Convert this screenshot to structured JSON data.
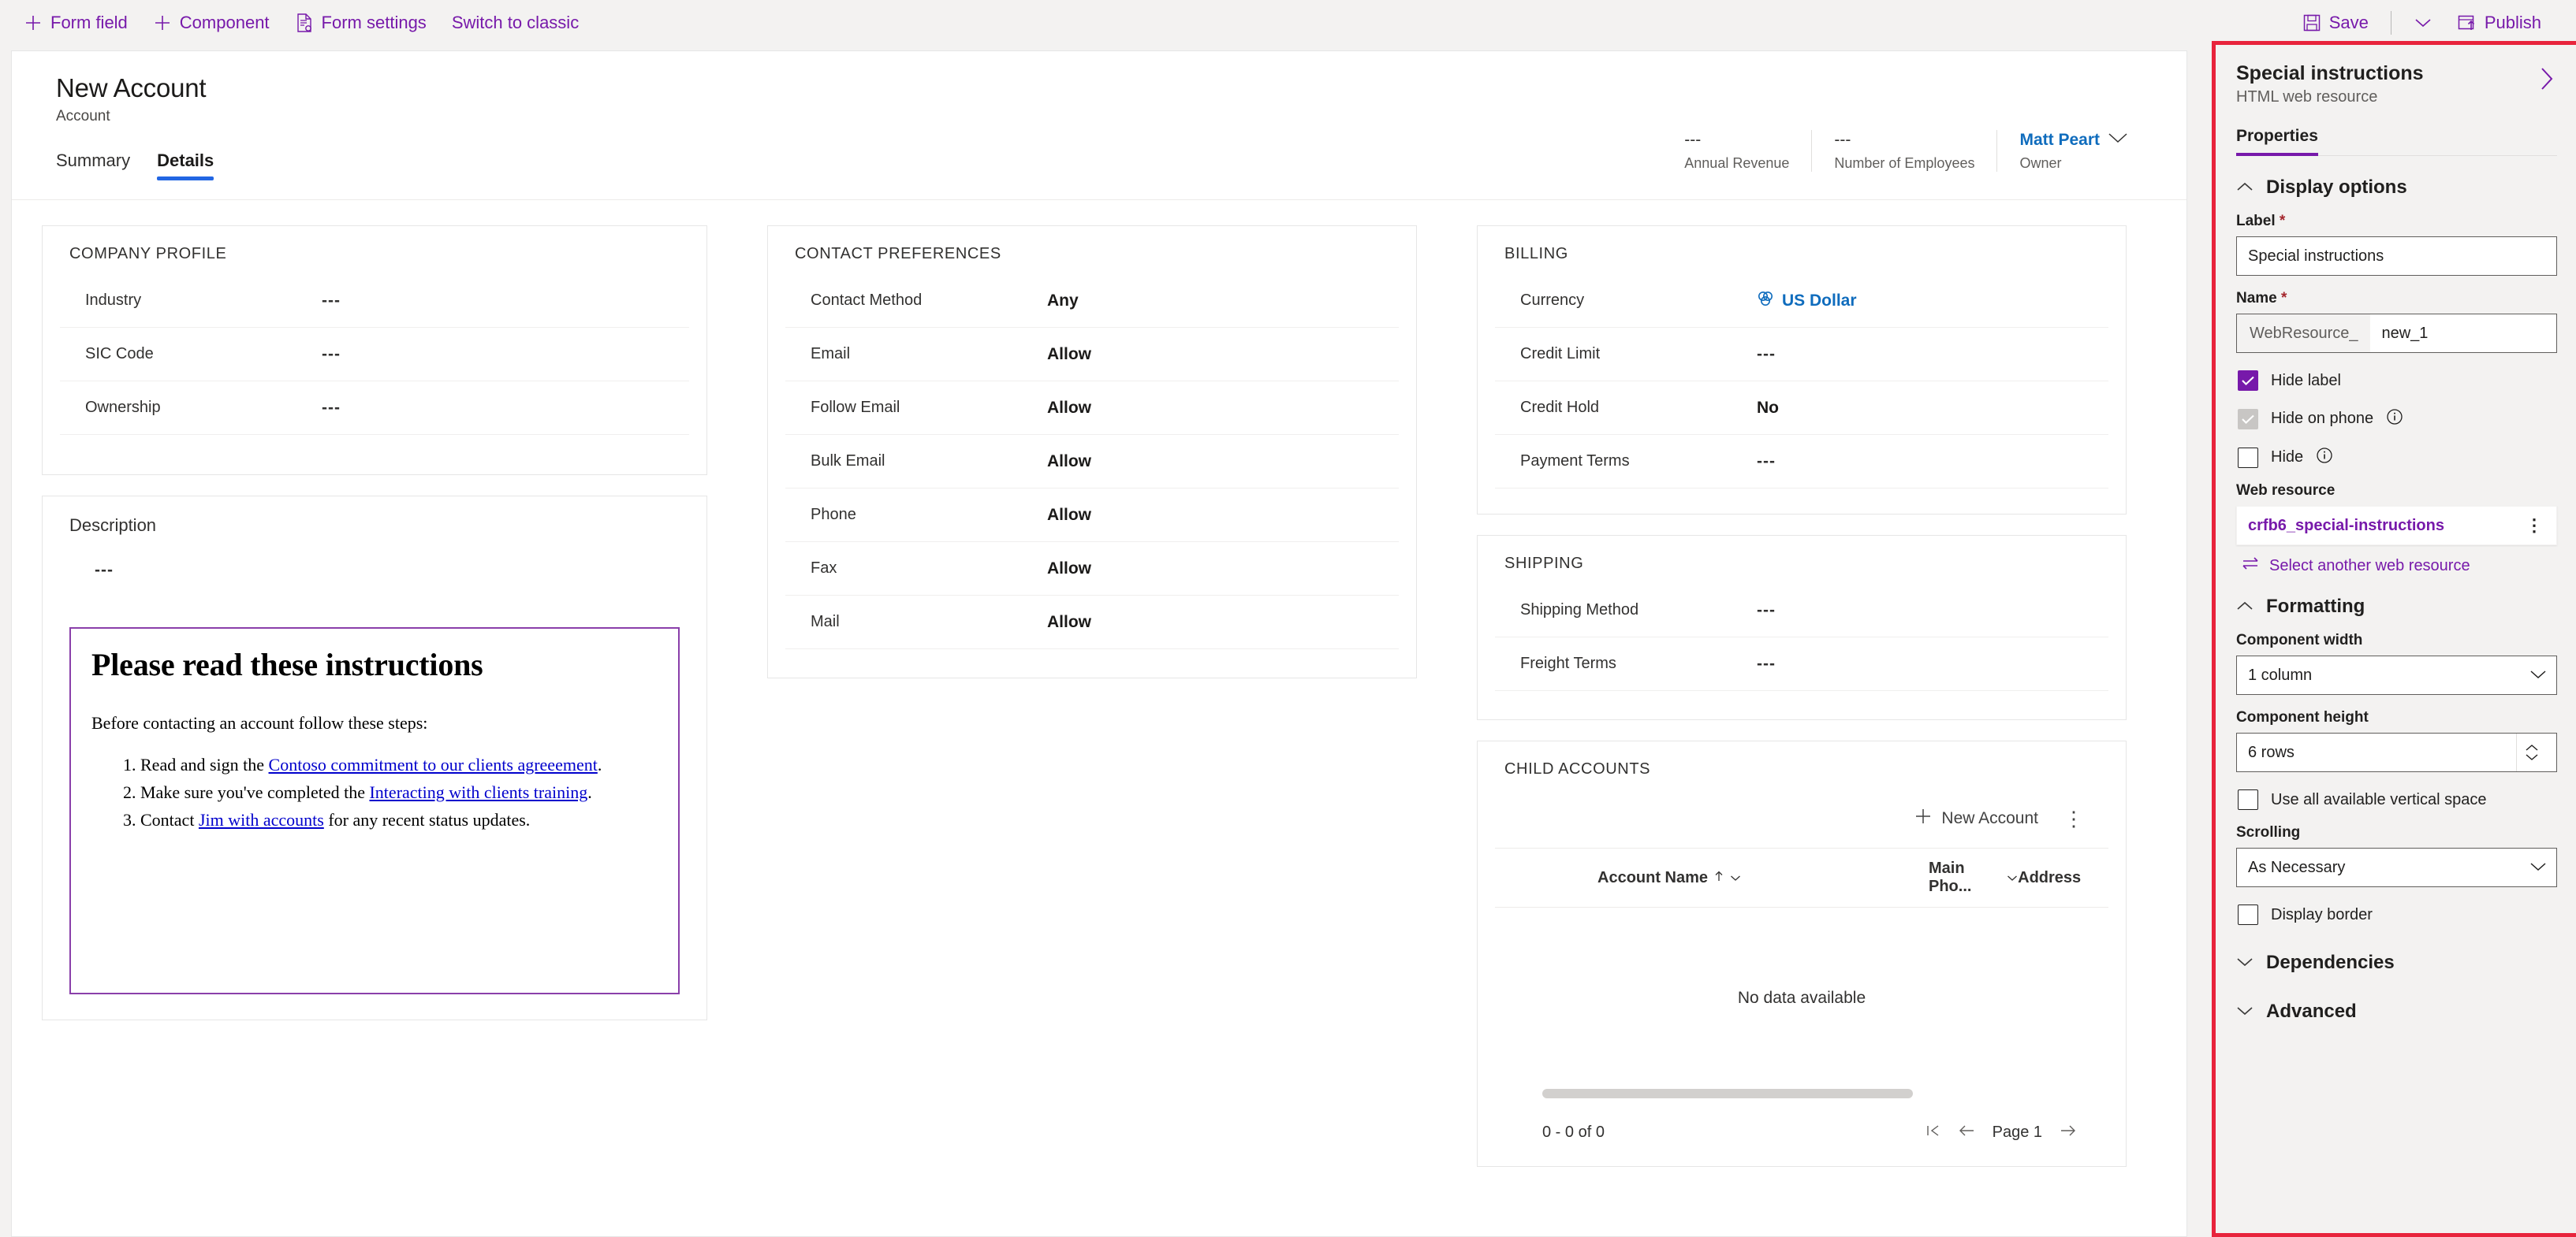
{
  "commandbar": {
    "left_items": [
      {
        "label": "Form field",
        "icon": "plus-icon"
      },
      {
        "label": "Component",
        "icon": "plus-icon"
      },
      {
        "label": "Form settings",
        "icon": "form-settings-icon"
      },
      {
        "label": "Switch to classic",
        "icon": "none"
      }
    ],
    "right_items": [
      {
        "label": "Save",
        "icon": "save-icon"
      },
      {
        "label": "",
        "icon": "chevron-down-icon"
      },
      {
        "label": "Publish",
        "icon": "publish-icon"
      }
    ]
  },
  "form": {
    "title": "New Account",
    "subtitle": "Account",
    "tabs": [
      {
        "label": "Summary",
        "active": false
      },
      {
        "label": "Details",
        "active": true
      }
    ],
    "header_fields": [
      {
        "value": "---",
        "label": "Annual Revenue"
      },
      {
        "value": "---",
        "label": "Number of Employees"
      },
      {
        "value": "Matt Peart",
        "label": "Owner"
      }
    ]
  },
  "sections": {
    "company_profile": {
      "title": "COMPANY PROFILE",
      "rows": [
        {
          "label": "Industry",
          "value": "---"
        },
        {
          "label": "SIC Code",
          "value": "---"
        },
        {
          "label": "Ownership",
          "value": "---"
        }
      ]
    },
    "description": {
      "title": "Description",
      "value": "---"
    },
    "contact_preferences": {
      "title": "CONTACT PREFERENCES",
      "rows": [
        {
          "label": "Contact Method",
          "value": "Any"
        },
        {
          "label": "Email",
          "value": "Allow"
        },
        {
          "label": "Follow Email",
          "value": "Allow"
        },
        {
          "label": "Bulk Email",
          "value": "Allow"
        },
        {
          "label": "Phone",
          "value": "Allow"
        },
        {
          "label": "Fax",
          "value": "Allow"
        },
        {
          "label": "Mail",
          "value": "Allow"
        }
      ]
    },
    "billing": {
      "title": "BILLING",
      "rows": [
        {
          "label": "Currency",
          "value": "US Dollar"
        },
        {
          "label": "Credit Limit",
          "value": "---"
        },
        {
          "label": "Credit Hold",
          "value": "No"
        },
        {
          "label": "Payment Terms",
          "value": "---"
        }
      ]
    },
    "shipping": {
      "title": "SHIPPING",
      "rows": [
        {
          "label": "Shipping Method",
          "value": "---"
        },
        {
          "label": "Freight Terms",
          "value": "---"
        }
      ]
    },
    "child_accounts": {
      "title": "CHILD ACCOUNTS",
      "new_button": "New Account",
      "columns": [
        "Account Name",
        "Main Pho...",
        "Address"
      ],
      "empty_text": "No data available",
      "record_count": "0 - 0 of 0",
      "page_label": "Page 1"
    }
  },
  "web_resource_preview": {
    "heading": "Please read these instructions",
    "intro": "Before contacting an account follow these steps:",
    "steps": [
      {
        "before": "Read and sign the ",
        "link": "Contoso commitment to our clients agreeement",
        "after": "."
      },
      {
        "before": "Make sure you've completed the ",
        "link": "Interacting with clients training",
        "after": "."
      },
      {
        "before": "Contact ",
        "link": "Jim with accounts",
        "after": " for any recent status updates."
      }
    ]
  },
  "panel": {
    "title": "Special instructions",
    "subtitle": "HTML web resource",
    "tab": "Properties",
    "display_options": {
      "heading": "Display options",
      "label_field_label": "Label",
      "label_field_value": "Special instructions",
      "name_field_label": "Name",
      "name_prefix": "WebResource_",
      "name_value": "new_1",
      "hide_label_checkbox": "Hide label",
      "hide_on_phone_checkbox": "Hide on phone",
      "hide_checkbox": "Hide",
      "web_resource_label": "Web resource",
      "web_resource_value": "crfb6_special-instructions",
      "select_another_label": "Select another web resource"
    },
    "formatting": {
      "heading": "Formatting",
      "component_width_label": "Component width",
      "component_width_value": "1 column",
      "component_height_label": "Component height",
      "component_height_value": "6 rows",
      "use_all_vertical_space": "Use all available vertical space",
      "scrolling_label": "Scrolling",
      "scrolling_value": "As Necessary",
      "display_border": "Display border"
    },
    "dependencies_heading": "Dependencies",
    "advanced_heading": "Advanced"
  },
  "colors": {
    "accent_purple": "#7719aa",
    "panel_highlight_red": "#e8243c",
    "link_blue": "#0f6cbd",
    "tab_underline_blue": "#2266e3",
    "webresource_border": "#8a3faa"
  }
}
